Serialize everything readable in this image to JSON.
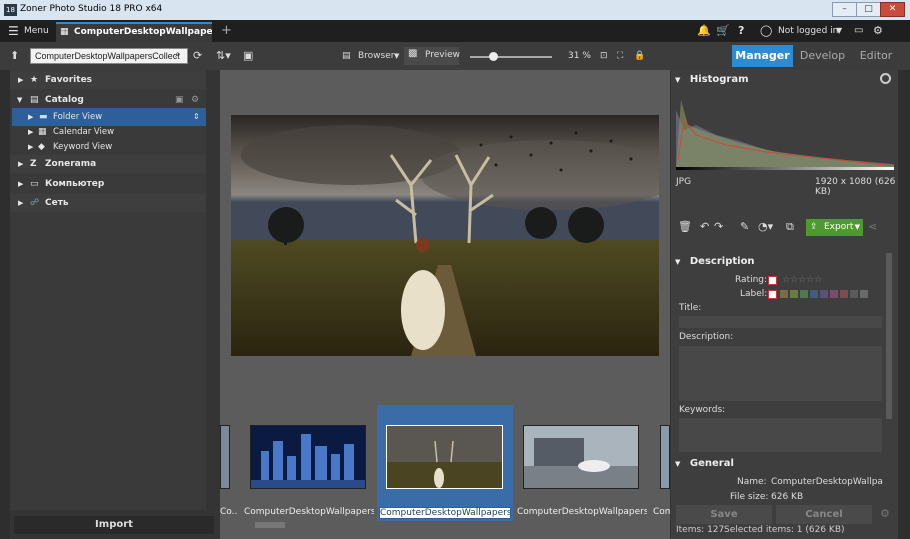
{
  "window": {
    "title": "Zoner Photo Studio 18 PRO x64",
    "logo": "18"
  },
  "menu": {
    "label": "Menu",
    "tab_label": "ComputerDesktopWallpapers...",
    "user": "Not logged in"
  },
  "toolbar": {
    "search_value": "ComputerDesktopWallpapersCollect",
    "browser": "Browser",
    "preview": "Preview",
    "zoom": "31 %"
  },
  "modes": [
    "Manager",
    "Develop",
    "Editor"
  ],
  "navigator": {
    "items": [
      {
        "label": "Favorites",
        "bold": true
      },
      {
        "label": "Catalog",
        "bold": true
      },
      {
        "label": "Folder View",
        "bold": false
      },
      {
        "label": "Calendar View",
        "bold": false
      },
      {
        "label": "Keyword View",
        "bold": false
      },
      {
        "label": "Zonerama",
        "bold": true
      },
      {
        "label": "Компьютер",
        "bold": true
      },
      {
        "label": "Сеть",
        "bold": true
      }
    ],
    "import_label": "Import"
  },
  "filmstrip": {
    "captions": [
      "Co...",
      "ComputerDesktopWallpapersCo...",
      "ComputerDesktopWallpapersCo...",
      "ComputerDesktopWallpapersCo...",
      "Com"
    ]
  },
  "histogram": {
    "title": "Histogram",
    "format": "JPG",
    "dims": "1920 x 1080 (626 KB)"
  },
  "actions": {
    "export": "Export"
  },
  "description": {
    "title": "Description",
    "rating_label": "Rating:",
    "label_label": "Label:",
    "title_field": "Title:",
    "desc_field": "Description:",
    "keywords_field": "Keywords:"
  },
  "general": {
    "title": "General",
    "name_label": "Name:",
    "name_value": "ComputerDesktopWallpapers",
    "size_label": "File size:",
    "size_value": "626 KB"
  },
  "buttons": {
    "save": "Save",
    "cancel": "Cancel"
  },
  "status": {
    "items": "Items: 127",
    "selected": "Selected items: 1 (626 KB)"
  },
  "colors": {
    "accent": "#2d8bd4",
    "selection": "#2d5f99",
    "export_green": "#4f9a2d"
  },
  "label_colors": [
    "#7b6b47",
    "#6b7a40",
    "#4e7a4e",
    "#3e5f7a",
    "#56527a",
    "#7a4e6b",
    "#7a4e4e",
    "#5a5a5a",
    "#6a6a6a"
  ]
}
